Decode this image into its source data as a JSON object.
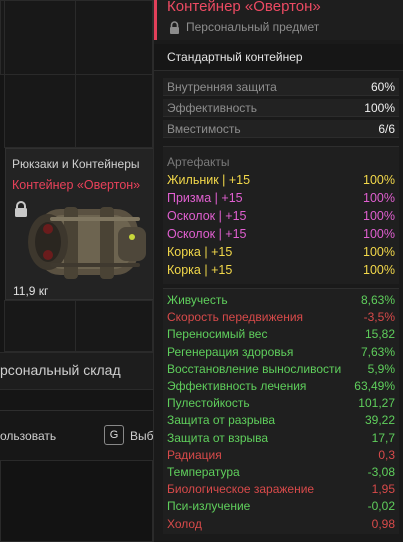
{
  "background": {
    "item_card": {
      "category": "Рюкзаки и Контейнеры",
      "name": "Контейнер «Овертон»",
      "weight": "11,9 кг",
      "locked_icon": "lock-icon",
      "image_icon": "container-item-icon"
    },
    "storage_label": "рсональный склад",
    "actions": {
      "use_label": "ользовать",
      "select_key": "G",
      "select_label": "Выб"
    }
  },
  "tooltip": {
    "title": "Контейнер «Овертон»",
    "subtitle": "Персональный предмет",
    "subtitle_icon": "lock-icon",
    "type": "Стандартный контейнер",
    "stats": [
      {
        "label": "Внутренняя защита",
        "value": "60%"
      },
      {
        "label": "Эффективность",
        "value": "100%"
      },
      {
        "label": "Вместимость",
        "value": "6/6"
      }
    ],
    "artifacts_header": "Артефакты",
    "artifacts": [
      {
        "label": "Жильник | +15",
        "value": "100%",
        "color": "#f2d84a"
      },
      {
        "label": "Призма | +15",
        "value": "100%",
        "color": "#e05fd0"
      },
      {
        "label": "Осколок | +15",
        "value": "100%",
        "color": "#e05fd0"
      },
      {
        "label": "Осколок | +15",
        "value": "100%",
        "color": "#e05fd0"
      },
      {
        "label": "Корка | +15",
        "value": "100%",
        "color": "#f2d84a"
      },
      {
        "label": "Корка | +15",
        "value": "100%",
        "color": "#f2d84a"
      }
    ],
    "properties": [
      {
        "label": "Живучесть",
        "value": "8,63%",
        "color": "#5fcf5c"
      },
      {
        "label": "Скорость передвижения",
        "value": "-3,5%",
        "color": "#d84a4a"
      },
      {
        "label": "Переносимый вес",
        "value": "15,82",
        "color": "#5fcf5c"
      },
      {
        "label": "Регенерация здоровья",
        "value": "7,63%",
        "color": "#5fcf5c"
      },
      {
        "label": "Восстановление выносливости",
        "value": "5,9%",
        "color": "#5fcf5c"
      },
      {
        "label": "Эффективность лечения",
        "value": "63,49%",
        "color": "#5fcf5c"
      },
      {
        "label": "Пулестойкость",
        "value": "101,27",
        "color": "#5fcf5c"
      },
      {
        "label": "Защита от разрыва",
        "value": "39,22",
        "color": "#5fcf5c"
      },
      {
        "label": "Защита от взрыва",
        "value": "17,7",
        "color": "#5fcf5c"
      },
      {
        "label": "Радиация",
        "value": "0,3",
        "color": "#d84a4a"
      },
      {
        "label": "Температура",
        "value": "-3,08",
        "color": "#5fcf5c"
      },
      {
        "label": "Биологическое заражение",
        "value": "1,95",
        "color": "#d84a4a"
      },
      {
        "label": "Пси-излучение",
        "value": "-0,02",
        "color": "#5fcf5c"
      },
      {
        "label": "Холод",
        "value": "0,98",
        "color": "#d84a4a"
      }
    ]
  }
}
